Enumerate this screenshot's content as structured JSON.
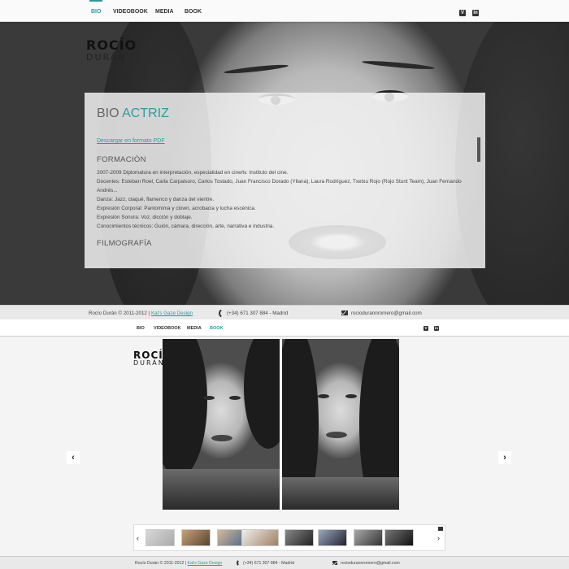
{
  "nav": {
    "items": [
      {
        "label": "BIO",
        "active": true
      },
      {
        "label": "VIDEOBOOK",
        "active": false
      },
      {
        "label": "MEDIA",
        "active": false
      },
      {
        "label": "BOOK",
        "active": false
      }
    ],
    "social": [
      "vimeo-icon",
      "linkedin-icon"
    ],
    "social_glyphs": {
      "vimeo": "V",
      "linkedin": "in"
    }
  },
  "logo": {
    "line1": "ROCÍO",
    "line2": "DURÁN"
  },
  "bio": {
    "title_part1": "BIO",
    "title_part2": "ACTRIZ",
    "pdf_link": "Descargar en formato PDF",
    "section1": "FORMACIÓN",
    "lines": [
      "2007-2009 Diplomatura en interpretación, especialidad en cine/tv. Instituto del cine.",
      "Docentes: Esteban Roel, Carla Carpalsoro, Carlos Tostado, Juan Francisco Dorado (Yllana), Laura Rodríguez, Txetxu Rojo (Rojo Stunt Team), Juan Fernando Andrés...",
      "Danza: Jazz, claqué, flamenco y danza del vientre.",
      "Expresión Corporal: Pantomima y clown, acrobacia y lucha escénica.",
      "Expresión Sonora: Voz, dicción y doblaje.",
      "Conocimientos técnicos: Guión, cámara, dirección, arte, narrativa e industria."
    ],
    "section2": "FILMOGRAFÍA"
  },
  "footer": {
    "copyright": "Rocío Durán © 2011-2012 |",
    "credit_link": "Kat's Gaze Design",
    "phone": "(+34) 671 307 884 - Madrid",
    "email": "rociodurannromero@gmail.com"
  },
  "bottom_nav": {
    "items": [
      {
        "label": "BIO",
        "active": false
      },
      {
        "label": "VIDEOBOOK",
        "active": false
      },
      {
        "label": "MEDIA",
        "active": false
      },
      {
        "label": "BOOK",
        "active": true
      }
    ]
  },
  "gallery": {
    "prev": "‹",
    "next": "›",
    "thumb_prev": "‹",
    "thumb_next": "›",
    "thumbnail_count": 8
  },
  "bottom_footer": {
    "copyright": "Rocío Durán © 2011-2012 |",
    "credit_link": "Kat's Gaze Design",
    "phone": "(+34) 671 307 884 - Madrid",
    "email": "rociodurannromero@gmail.com"
  },
  "colors": {
    "accent": "#2a9d9b",
    "text": "#444444",
    "nav_bg": "#fafafa"
  }
}
